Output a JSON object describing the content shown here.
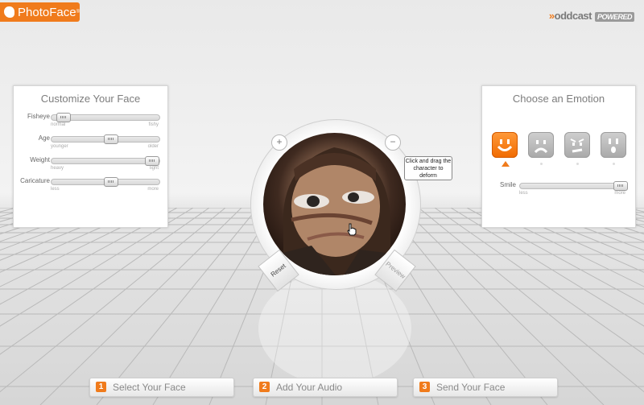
{
  "brand": {
    "name": "PhotoFace",
    "mark": "®"
  },
  "partner": {
    "name": "oddcast",
    "prefix": "»",
    "badge": "POWERED"
  },
  "customize": {
    "title": "Customize Your Face",
    "sliders": [
      {
        "label": "Fisheye",
        "min_label": "normal",
        "max_label": "fishy",
        "value": 0.05
      },
      {
        "label": "Age",
        "min_label": "younger",
        "max_label": "older",
        "value": 0.55
      },
      {
        "label": "Weight",
        "min_label": "heavy",
        "max_label": "light",
        "value": 0.98
      },
      {
        "label": "Caricature",
        "min_label": "less",
        "max_label": "more",
        "value": 0.55
      }
    ]
  },
  "emotion": {
    "title": "Choose an Emotion",
    "options": [
      "happy",
      "sad",
      "angry",
      "surprised"
    ],
    "selected": "happy",
    "smile": {
      "label": "Smile",
      "min_label": "less",
      "max_label": "more",
      "value": 1.0
    }
  },
  "viewer": {
    "zoom_in": "+",
    "zoom_out": "−",
    "reset_label": "Reset",
    "other_label": "Preview",
    "tooltip": "Click and drag the character to deform"
  },
  "steps": [
    {
      "num": "1",
      "label": "Select Your Face"
    },
    {
      "num": "2",
      "label": "Add Your Audio"
    },
    {
      "num": "3",
      "label": "Send Your Face"
    }
  ],
  "colors": {
    "accent": "#f07b1c",
    "panel_bg": "#ffffff",
    "text_muted": "#8a8a8a"
  }
}
